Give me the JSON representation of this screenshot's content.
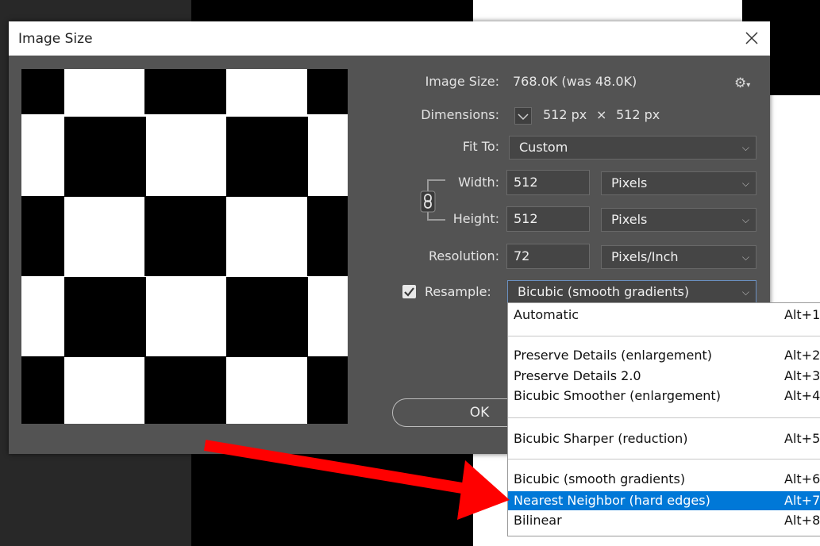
{
  "dialog": {
    "title": "Image Size",
    "image_size_label": "Image Size:",
    "image_size_value": "768.0K (was 48.0K)",
    "dimensions_label": "Dimensions:",
    "dimensions_w": "512 px",
    "dimensions_x": "×",
    "dimensions_h": "512 px",
    "fit_to_label": "Fit To:",
    "fit_to_value": "Custom",
    "width_label": "Width:",
    "width_value": "512",
    "width_unit": "Pixels",
    "height_label": "Height:",
    "height_value": "512",
    "height_unit": "Pixels",
    "resolution_label": "Resolution:",
    "resolution_value": "72",
    "resolution_unit": "Pixels/Inch",
    "resample_label": "Resample:",
    "resample_value": "Bicubic (smooth gradients)",
    "resample_checked": true,
    "ok_label": "OK"
  },
  "resample_menu": {
    "items": [
      {
        "name": "Automatic",
        "shortcut": "Alt+1"
      },
      {
        "name": "Preserve Details (enlargement)",
        "shortcut": "Alt+2"
      },
      {
        "name": "Preserve Details 2.0",
        "shortcut": "Alt+3"
      },
      {
        "name": "Bicubic Smoother (enlargement)",
        "shortcut": "Alt+4"
      },
      {
        "name": "Bicubic Sharper (reduction)",
        "shortcut": "Alt+5"
      },
      {
        "name": "Bicubic (smooth gradients)",
        "shortcut": "Alt+6"
      },
      {
        "name": "Nearest Neighbor (hard edges)",
        "shortcut": "Alt+7"
      },
      {
        "name": "Bilinear",
        "shortcut": "Alt+8"
      }
    ],
    "highlighted": "Nearest Neighbor (hard edges)"
  },
  "icons": {
    "close": "close-icon",
    "settings": "gear-icon",
    "link": "chain-link-icon",
    "toggle": "chevron-down-icon",
    "annotation": "red-arrow"
  },
  "colors": {
    "dialog_bg": "#535353",
    "highlight": "#0078d7",
    "arrow": "#ff0000"
  }
}
